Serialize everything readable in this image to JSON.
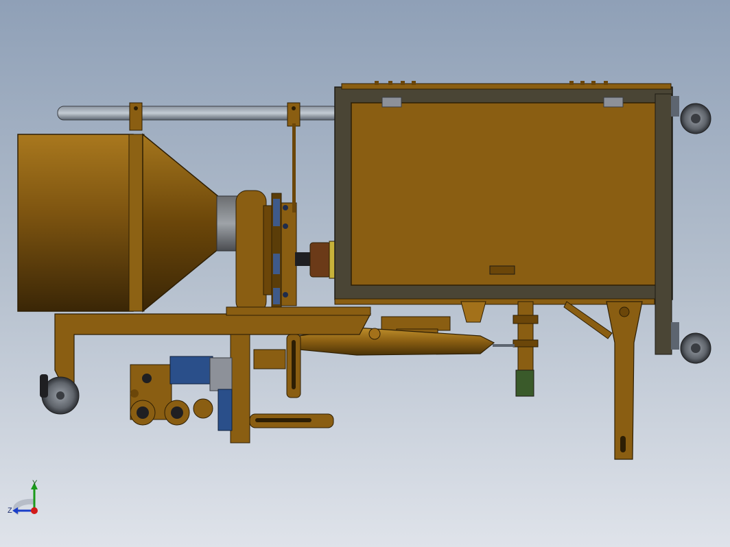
{
  "view": {
    "background_top": "#8fa0b7",
    "background_bottom": "#dfe3ea",
    "part_color": "#8a5e12",
    "part_dark": "#4a3206",
    "frame_color": "#4a4535",
    "motor_blue": "#2a4f8a"
  },
  "triad": {
    "y_label": "Y",
    "z_label": "Z",
    "y_color": "#1a9a1a",
    "z_color": "#1a3ec8",
    "x_color": "#d21a1a"
  }
}
